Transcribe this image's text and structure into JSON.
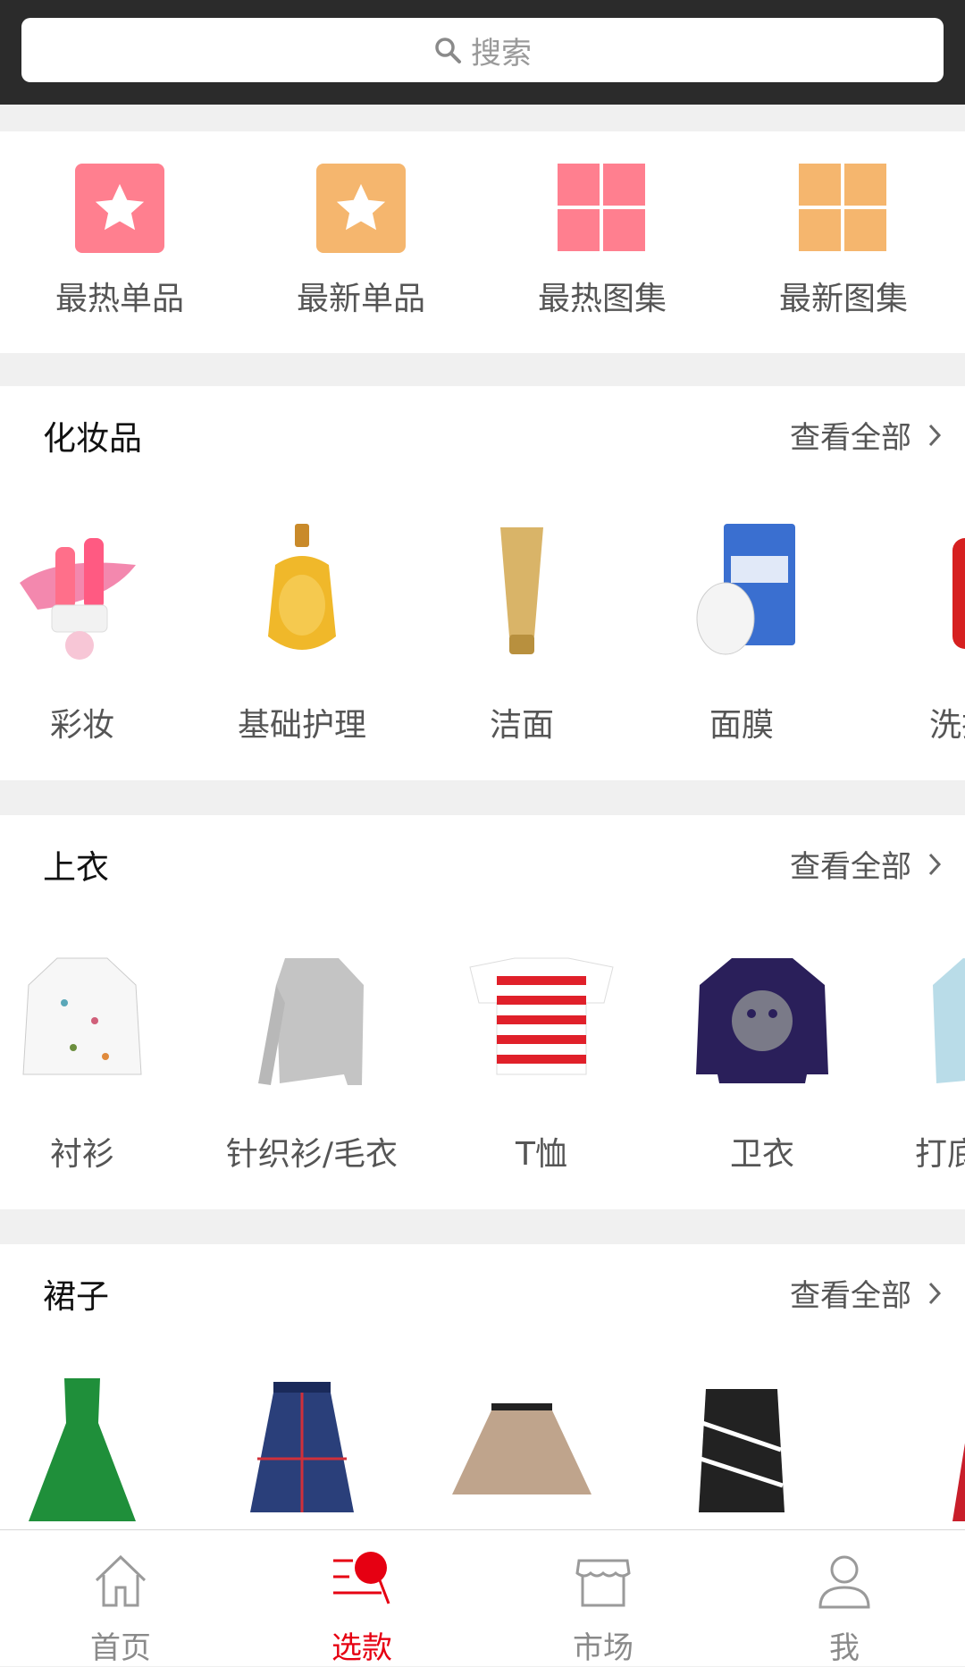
{
  "search": {
    "placeholder": "搜索"
  },
  "quick_entries": [
    {
      "label": "最热单品",
      "icon": "star-icon",
      "color": "#ff7f8f"
    },
    {
      "label": "最新单品",
      "icon": "star-icon",
      "color": "#f5b66e"
    },
    {
      "label": "最热图集",
      "icon": "grid-icon",
      "color": "#ff7f8f"
    },
    {
      "label": "最新图集",
      "icon": "grid-icon",
      "color": "#f5b66e"
    }
  ],
  "sections": [
    {
      "title": "化妆品",
      "more": "查看全部",
      "items": [
        "彩妆",
        "基础护理",
        "洁面",
        "面膜",
        "洗护"
      ]
    },
    {
      "title": "上衣",
      "more": "查看全部",
      "items": [
        "衬衫",
        "针织衫/毛衣",
        "T恤",
        "卫衣",
        "打底衫"
      ]
    },
    {
      "title": "裙子",
      "more": "查看全部",
      "items": [
        "",
        "",
        "",
        "",
        ""
      ]
    }
  ],
  "tabbar": {
    "tabs": [
      {
        "label": "首页",
        "icon": "home-icon"
      },
      {
        "label": "选款",
        "icon": "pick-style-icon",
        "active": true
      },
      {
        "label": "市场",
        "icon": "store-icon"
      },
      {
        "label": "我",
        "icon": "person-icon"
      }
    ],
    "active_color": "#e60012",
    "inactive_color": "#8a8a8a"
  }
}
